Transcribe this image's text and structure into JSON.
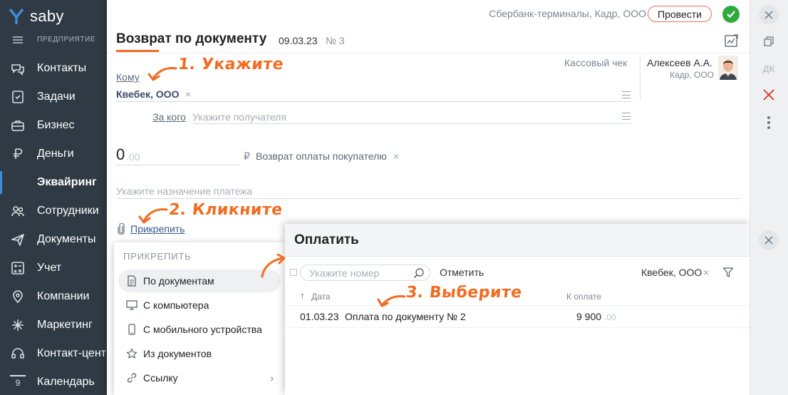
{
  "app": {
    "brand": "saby",
    "section": "ПРЕДПРИЯТИЕ",
    "accent": "#f26b21"
  },
  "sidebar": {
    "items": [
      {
        "label": "Контакты",
        "icon": "chat-bubbles-icon"
      },
      {
        "label": "Задачи",
        "icon": "task-checklist-icon"
      },
      {
        "label": "Бизнес",
        "icon": "briefcase-icon"
      },
      {
        "label": "Деньги",
        "icon": "ruble-icon"
      },
      {
        "label": "Эквайринг",
        "icon": "",
        "sub": true,
        "active": true
      },
      {
        "label": "Сотрудники",
        "icon": "people-icon"
      },
      {
        "label": "Документы",
        "icon": "paper-plane-icon"
      },
      {
        "label": "Учет",
        "icon": "calculator-icon"
      },
      {
        "label": "Компании",
        "icon": "location-pin-icon"
      },
      {
        "label": "Маркетинг",
        "icon": "sparkle-icon"
      },
      {
        "label": "Контакт-центр",
        "icon": "headset-icon"
      },
      {
        "label": "Календарь",
        "icon": "calendar-icon",
        "badge": "9"
      }
    ]
  },
  "document": {
    "org": "Сбербанк-терминалы, Кадр, ООО",
    "post_button": "Провести",
    "title": "Возврат по документу",
    "date": "09.03.23",
    "number": "№ 3",
    "kassa_label": "Кассовый чек",
    "responsible_name": "Алексеев А.А.",
    "responsible_org": "Кадр, ООО",
    "to_label": "Кому",
    "recipient": "Квебек, ООО",
    "for_whom_label": "За кого",
    "for_whom_placeholder": "Укажите получателя",
    "amount_int": "0",
    "amount_frac": ".00",
    "currency": "₽",
    "payment_type": "Возврат оплаты покупателю",
    "purpose_placeholder": "Укажите назначение платежа",
    "attach_link": "Прикрепить"
  },
  "attach_menu": {
    "title": "ПРИКРЕПИТЬ",
    "items": [
      {
        "label": "По документам",
        "icon": "document-icon",
        "active": true
      },
      {
        "label": "С компьютера",
        "icon": "monitor-icon"
      },
      {
        "label": "С мобильного устройства",
        "icon": "smartphone-icon"
      },
      {
        "label": "Из документов",
        "icon": "star-icon"
      },
      {
        "label": "Ссылку",
        "icon": "link-icon",
        "submenu": true
      }
    ]
  },
  "pay_popup": {
    "title": "Оплатить",
    "search_placeholder": "Укажите номер",
    "mark_label": "Отметить",
    "filter_org": "Квебек, ООО",
    "col_date": "Дата",
    "col_amount": "К оплате",
    "rows": [
      {
        "date": "01.03.23",
        "desc": "Оплата по документу № 2",
        "amount": "9 900",
        "amount_frac": ".00"
      }
    ]
  },
  "right_toolbar": {
    "dk_label": "ДК"
  },
  "annotations": {
    "step1": "1. Укажите",
    "step2": "2. Кликните",
    "step3": "3. Выберите"
  }
}
